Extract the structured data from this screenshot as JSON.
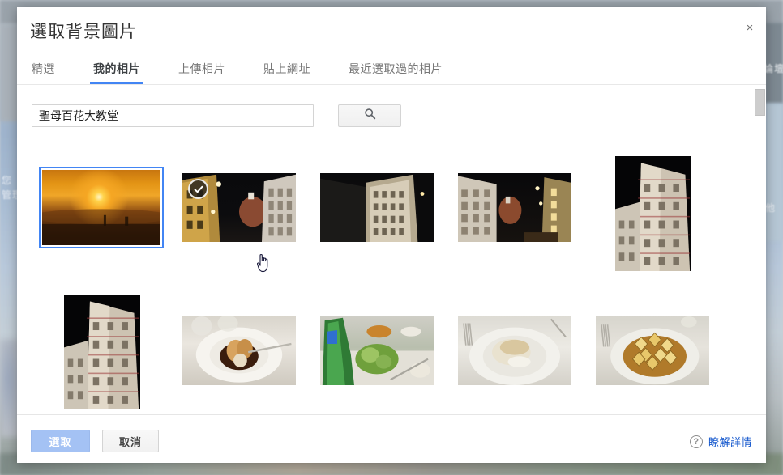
{
  "theme": {
    "accent": "#4285f4",
    "primary_button_bg": "#a4c2f4",
    "link_color": "#1155cc",
    "dialog_bg": "#ffffff"
  },
  "dialog": {
    "title": "選取背景圖片",
    "close_label": "×"
  },
  "tabs": [
    {
      "label": "精選",
      "active": false
    },
    {
      "label": "我的相片",
      "active": true
    },
    {
      "label": "上傳相片",
      "active": false
    },
    {
      "label": "貼上網址",
      "active": false
    },
    {
      "label": "最近選取過的相片",
      "active": false
    }
  ],
  "search": {
    "value": "聖母百花大教堂",
    "placeholder": "",
    "button_icon": "search-icon"
  },
  "photos": [
    {
      "id": 1,
      "alt": "日落城市剪影",
      "orientation": "landscape",
      "selected": true,
      "checked": false
    },
    {
      "id": 2,
      "alt": "夜晚教堂與街屋",
      "orientation": "landscape",
      "selected": false,
      "checked": true
    },
    {
      "id": 3,
      "alt": "大教堂外牆仰角",
      "orientation": "landscape",
      "selected": false,
      "checked": false
    },
    {
      "id": 4,
      "alt": "夜晚教堂與街景",
      "orientation": "landscape",
      "selected": false,
      "checked": false
    },
    {
      "id": 5,
      "alt": "喬托鐘樓夜景",
      "orientation": "portrait",
      "selected": false,
      "checked": false
    },
    {
      "id": 6,
      "alt": "鐘樓夜間仰拍",
      "orientation": "portrait",
      "selected": false,
      "checked": false
    },
    {
      "id": 7,
      "alt": "巧克力泡芙甜點",
      "orientation": "landscape",
      "selected": false,
      "checked": false
    },
    {
      "id": 8,
      "alt": "餐桌綠酒瓶沙拉",
      "orientation": "landscape",
      "selected": false,
      "checked": false
    },
    {
      "id": 9,
      "alt": "白醬魚排主菜",
      "orientation": "landscape",
      "selected": false,
      "checked": false
    },
    {
      "id": 10,
      "alt": "義大利麵餃",
      "orientation": "landscape",
      "selected": false,
      "checked": false
    }
  ],
  "footer": {
    "select_label": "選取",
    "cancel_label": "取消",
    "help_label": "瞭解詳情",
    "help_icon": "question-mark-icon"
  },
  "background": {
    "text_left_1": "您",
    "text_left_2": "管理",
    "text_right_1": "論壇",
    "text_right_2": "他"
  },
  "cursor": {
    "type": "pointer-hand"
  }
}
